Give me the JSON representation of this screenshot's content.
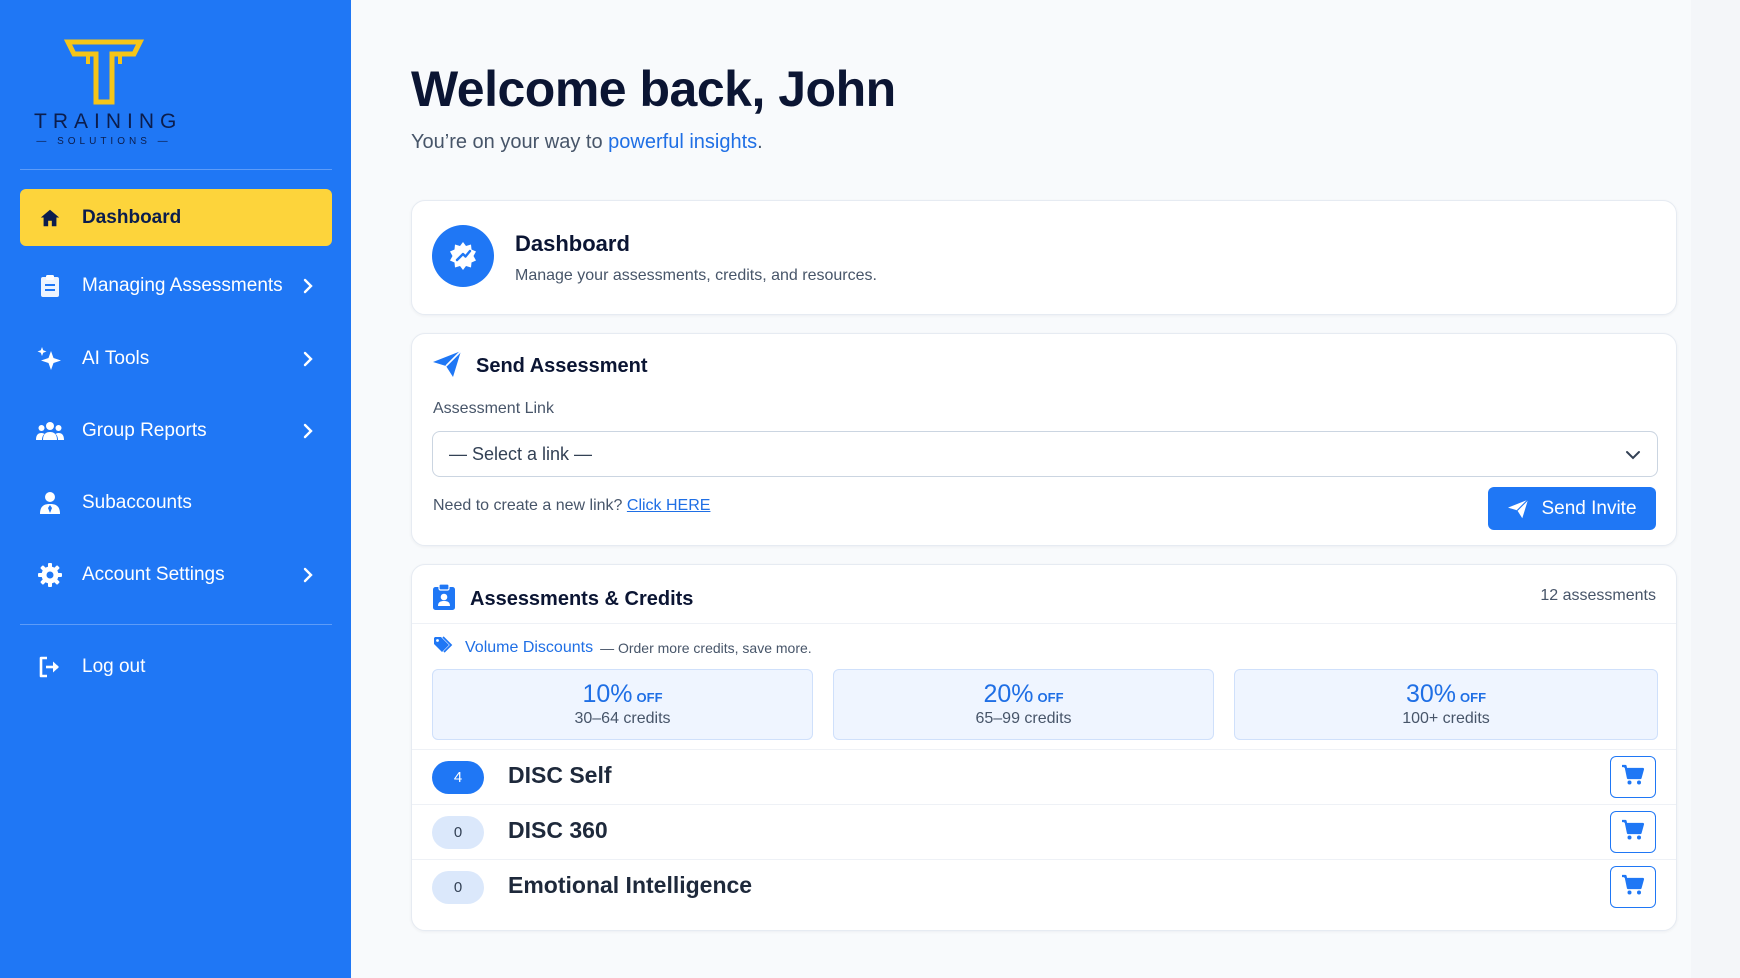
{
  "colors": {
    "sidebar": "#1f77f5",
    "active_item": "#fdd43b",
    "accent": "#1f6fe5",
    "logo_gold": "#f5c518",
    "logo_text": "#0b1d4d"
  },
  "logo": {
    "word": "TRAINING",
    "sub": "— SOLUTIONS —"
  },
  "sidebar": {
    "items": [
      {
        "label": "Dashboard",
        "icon": "home-icon",
        "active": true,
        "chevron": false
      },
      {
        "label": "Managing Assessments",
        "icon": "clipboard-icon",
        "active": false,
        "chevron": true
      },
      {
        "label": "AI Tools",
        "icon": "sparkles-icon",
        "active": false,
        "chevron": true
      },
      {
        "label": "Group Reports",
        "icon": "users-icon",
        "active": false,
        "chevron": true
      },
      {
        "label": "Subaccounts",
        "icon": "user-tie-icon",
        "active": false,
        "chevron": false
      },
      {
        "label": "Account Settings",
        "icon": "gear-icon",
        "active": false,
        "chevron": true
      }
    ],
    "logout": {
      "label": "Log out",
      "icon": "logout-icon"
    }
  },
  "header": {
    "welcome": "Welcome back, John",
    "subtitle_prefix": "You’re on your way to ",
    "subtitle_accent": "powerful insights",
    "subtitle_suffix": "."
  },
  "dashboard_card": {
    "title": "Dashboard",
    "description": "Manage your assessments, credits, and resources.",
    "icon": "gauge-icon"
  },
  "send_assessment": {
    "title": "Send Assessment",
    "icon": "paper-plane-icon",
    "field_label": "Assessment Link",
    "select_value": "— Select a link —",
    "help_text": "Need to create a new link? ",
    "help_link": "Click HERE",
    "button_label": "Send Invite"
  },
  "credits": {
    "title": "Assessments & Credits",
    "icon": "clipboard-user-icon",
    "count": "12 assessments",
    "volume_label": "Volume Discounts",
    "volume_desc": "— Order more credits, save more.",
    "tiers": [
      {
        "pct": "10%",
        "off": "OFF",
        "range": "30–64 credits"
      },
      {
        "pct": "20%",
        "off": "OFF",
        "range": "65–99 credits"
      },
      {
        "pct": "30%",
        "off": "OFF",
        "range": "100+ credits"
      }
    ],
    "rows": [
      {
        "count": "4",
        "name": "DISC Self",
        "highlight": true
      },
      {
        "count": "0",
        "name": "DISC 360",
        "highlight": false
      },
      {
        "count": "0",
        "name": "Emotional Intelligence",
        "highlight": false
      }
    ]
  }
}
